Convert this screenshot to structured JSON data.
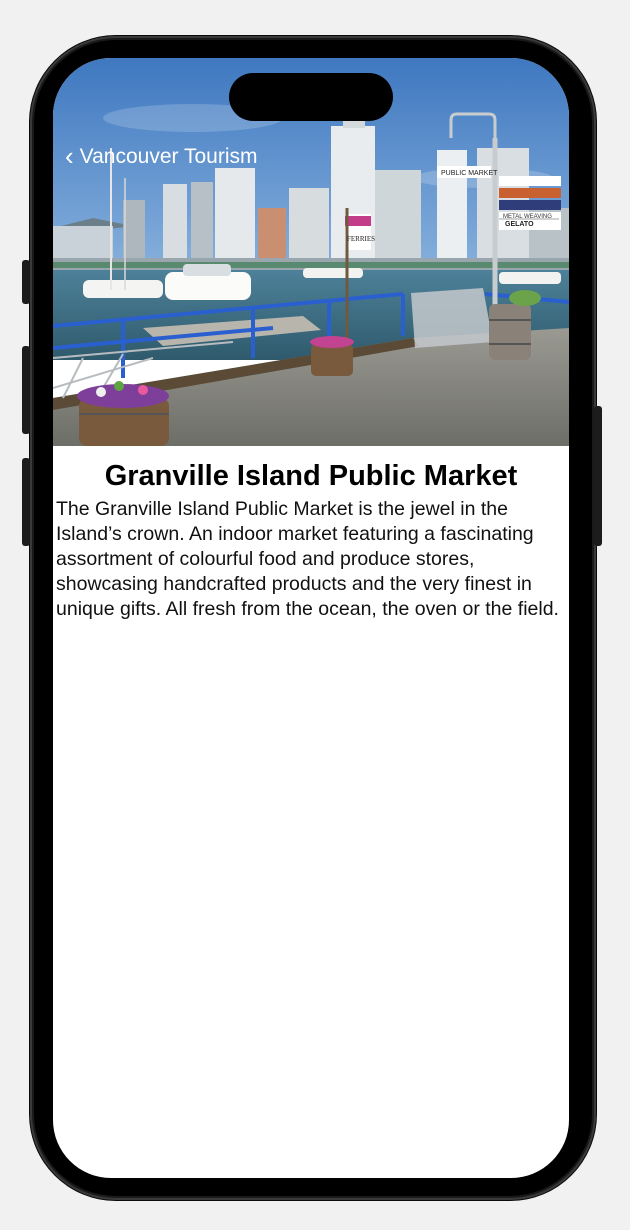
{
  "nav": {
    "back_label": "Vancouver Tourism"
  },
  "hero": {
    "signs": [
      "PUBLIC MARKET",
      "GELATO",
      "METAL WEAVING",
      "FERRIES"
    ]
  },
  "detail": {
    "title": "Granville Island Public Market",
    "description": "The Granville Island Public Market is the jewel in the Island’s crown. An indoor market featuring a fascinating assortment of colourful food and produce stores, showcasing handcrafted products and the very finest in unique gifts. All fresh from the ocean, the oven or the field."
  },
  "colors": {
    "sky": "#4f86c6",
    "water": "#3d6e86",
    "railing": "#2a5fd0",
    "pier": "#8e8e88"
  }
}
